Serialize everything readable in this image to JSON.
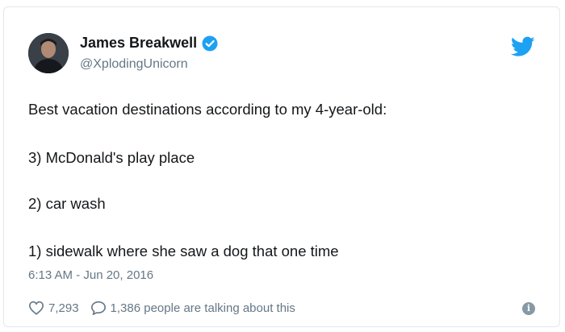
{
  "author": {
    "name": "James Breakwell",
    "handle": "@XplodingUnicorn",
    "verified": true
  },
  "tweet": {
    "lines": [
      "Best vacation destinations according to my 4-year-old:",
      "3) McDonald's play place",
      "2) car wash",
      "1) sidewalk where she saw a dog that one time"
    ],
    "timestamp": "6:13 AM - Jun 20, 2016"
  },
  "actions": {
    "likes": "7,293",
    "replies_text": "1,386 people are talking about this"
  },
  "icons": {
    "logo": "twitter-bird-icon",
    "verified": "verified-badge-icon",
    "like": "heart-icon",
    "reply": "speech-bubble-icon",
    "info": "info-icon"
  },
  "colors": {
    "brand": "#1da1f2",
    "text": "#14171a",
    "muted": "#657786",
    "border": "#e1e8ed"
  }
}
